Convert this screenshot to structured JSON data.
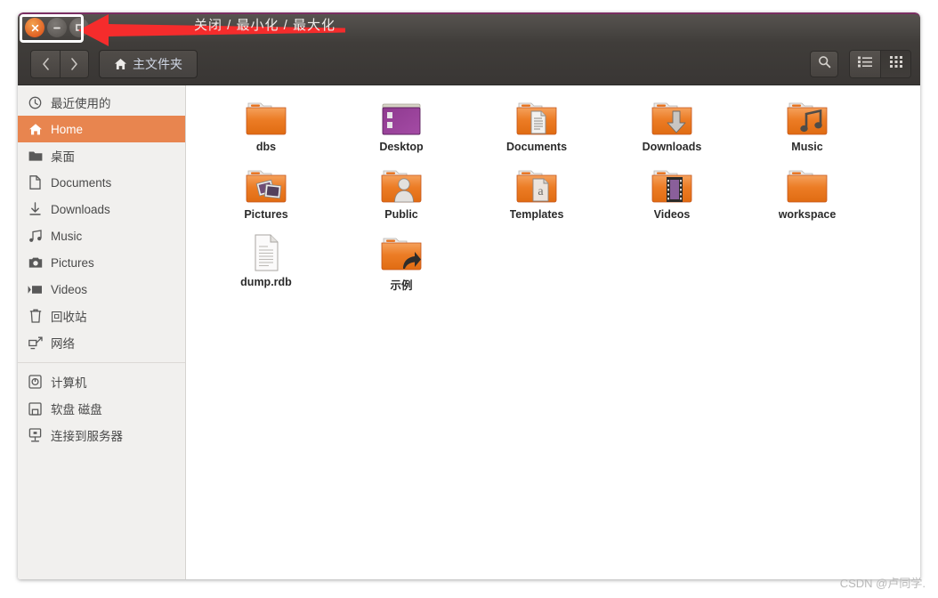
{
  "window": {
    "titlebar_annotation": "关闭 / 最小化 / 最大化",
    "controls": {
      "close_label": "close-button",
      "minimize_label": "minimize-button",
      "maximize_label": "maximize-button"
    }
  },
  "toolbar": {
    "back_label": "‹",
    "forward_label": "›",
    "breadcrumb_icon": "home-icon",
    "breadcrumb_label": "主文件夹",
    "search_label": "search-icon",
    "list_view_label": "list-view-icon",
    "grid_view_label": "grid-view-icon",
    "active_view": "grid"
  },
  "sidebar": {
    "items": [
      {
        "label": "最近使用的",
        "icon": "clock-icon",
        "active": false
      },
      {
        "label": "Home",
        "icon": "home-icon",
        "active": true
      },
      {
        "label": "桌面",
        "icon": "folder-icon",
        "active": false
      },
      {
        "label": "Documents",
        "icon": "document-icon",
        "active": false
      },
      {
        "label": "Downloads",
        "icon": "download-icon",
        "active": false
      },
      {
        "label": "Music",
        "icon": "music-icon",
        "active": false
      },
      {
        "label": "Pictures",
        "icon": "camera-icon",
        "active": false
      },
      {
        "label": "Videos",
        "icon": "video-icon",
        "active": false
      },
      {
        "label": "回收站",
        "icon": "trash-icon",
        "active": false
      },
      {
        "label": "网络",
        "icon": "network-icon",
        "active": false
      }
    ],
    "devices": [
      {
        "label": "计算机",
        "icon": "computer-icon"
      },
      {
        "label": "软盘 磁盘",
        "icon": "floppy-icon"
      },
      {
        "label": "连接到服务器",
        "icon": "server-icon"
      }
    ]
  },
  "files": [
    {
      "name": "dbs",
      "type": "folder",
      "emblem": "none"
    },
    {
      "name": "Desktop",
      "type": "folder-desktop",
      "emblem": "desktop"
    },
    {
      "name": "Documents",
      "type": "folder",
      "emblem": "document"
    },
    {
      "name": "Downloads",
      "type": "folder",
      "emblem": "download"
    },
    {
      "name": "Music",
      "type": "folder",
      "emblem": "music"
    },
    {
      "name": "Pictures",
      "type": "folder",
      "emblem": "picture"
    },
    {
      "name": "Public",
      "type": "folder",
      "emblem": "person"
    },
    {
      "name": "Templates",
      "type": "folder",
      "emblem": "template"
    },
    {
      "name": "Videos",
      "type": "folder",
      "emblem": "film"
    },
    {
      "name": "workspace",
      "type": "folder",
      "emblem": "none"
    },
    {
      "name": "dump.rdb",
      "type": "file",
      "emblem": "none"
    },
    {
      "name": "示例",
      "type": "folder",
      "emblem": "link"
    }
  ],
  "annotation": {
    "arrow_color": "#f52c2c",
    "highlight_color": "#ffffff"
  },
  "watermark": "CSDN @卢同学.",
  "colors": {
    "titlebar": "#4a4744",
    "accent_orange": "#e8854f",
    "sidebar_bg": "#f1f0ee",
    "folder_orange": "#e8701a"
  }
}
